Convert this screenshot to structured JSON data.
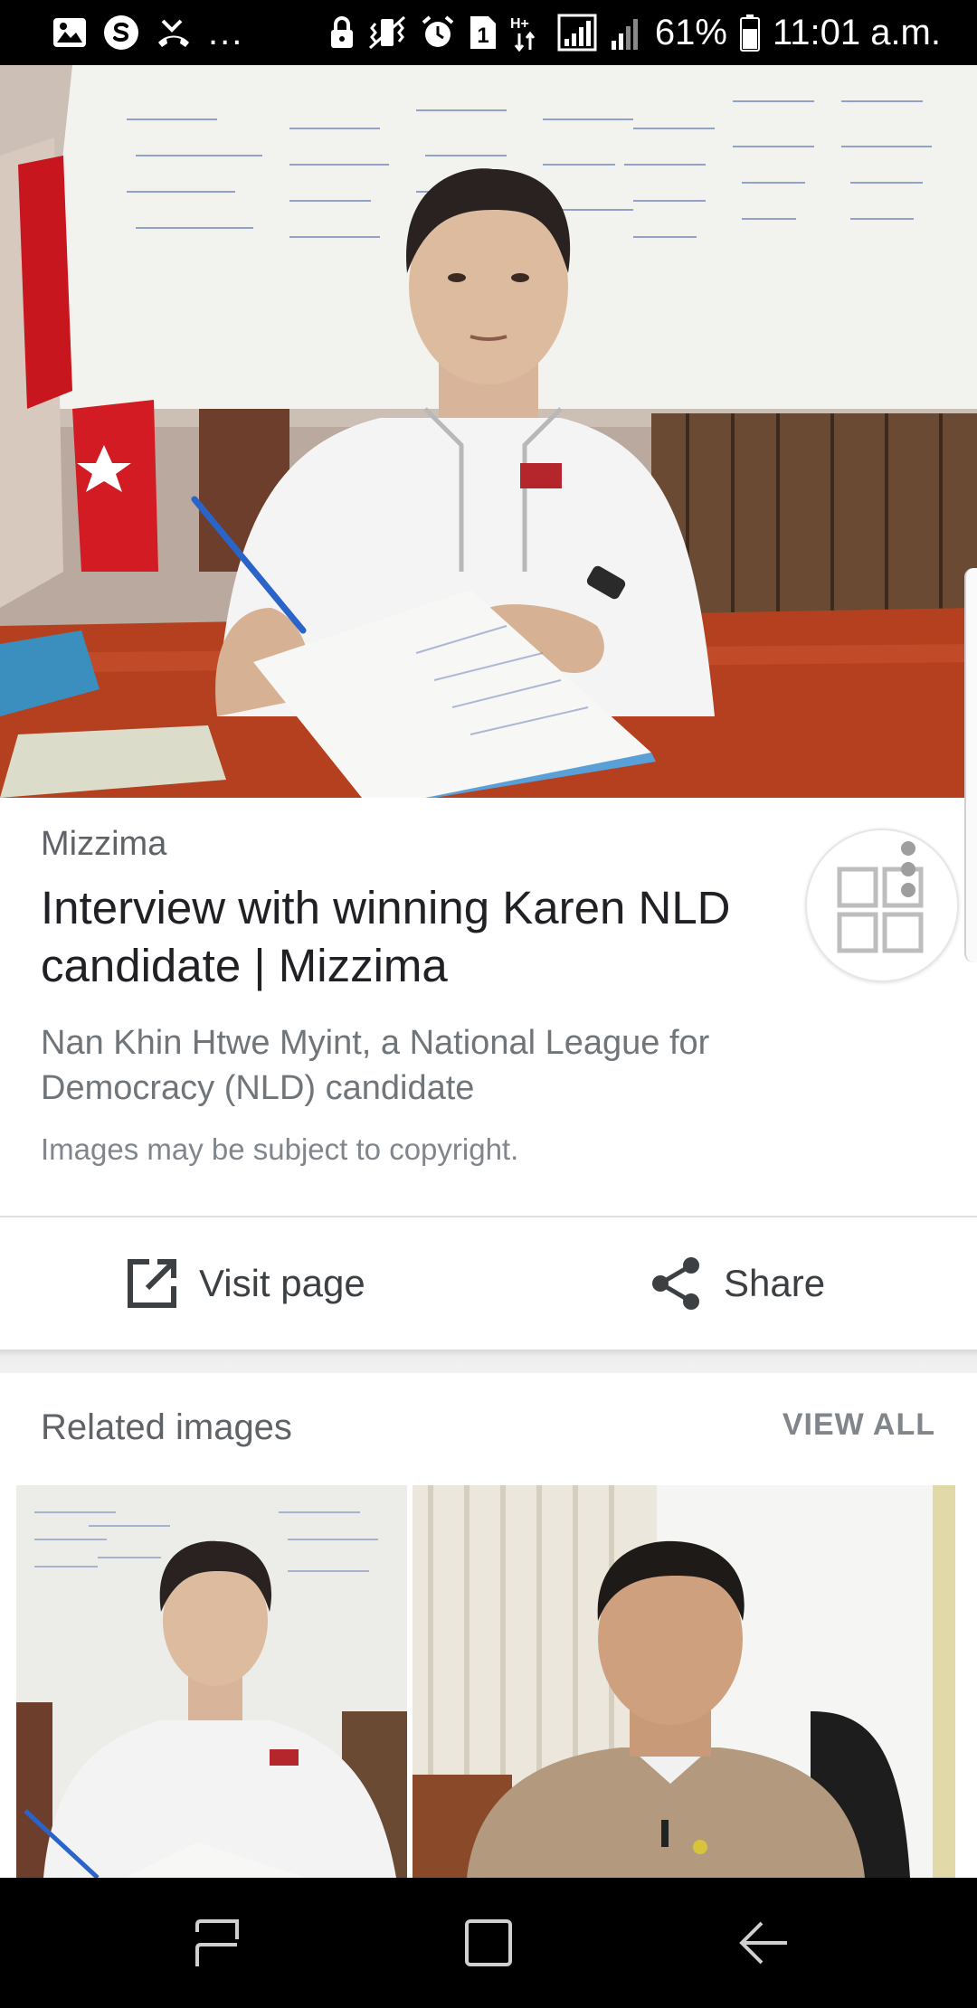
{
  "status_bar": {
    "left_icons": [
      "gallery-icon",
      "skype-icon",
      "missed-call-icon"
    ],
    "overflow": "...",
    "right_icons": [
      "lock-icon",
      "vibrate-icon",
      "alarm-icon",
      "sim-icon",
      "hplus-signal-icon",
      "signal-icon",
      "signal-2-icon",
      "battery-icon"
    ],
    "sim_label": "1",
    "network_label": "H+",
    "battery": "61%",
    "time": "11:01 a.m."
  },
  "image_detail": {
    "source": "Mizzima",
    "title": "Interview with winning Karen NLD candidate | Mizzima",
    "description": "Nan Khin Htwe Myint, a National League for Democracy (NLD) candidate",
    "copyright": "Images may be subject to copyright."
  },
  "actions": {
    "visit_label": "Visit page",
    "share_label": "Share"
  },
  "related": {
    "title": "Related images",
    "view_all": "VIEW ALL"
  },
  "nav_bar": {
    "icons": [
      "recent-apps-icon",
      "home-icon",
      "back-icon"
    ]
  }
}
